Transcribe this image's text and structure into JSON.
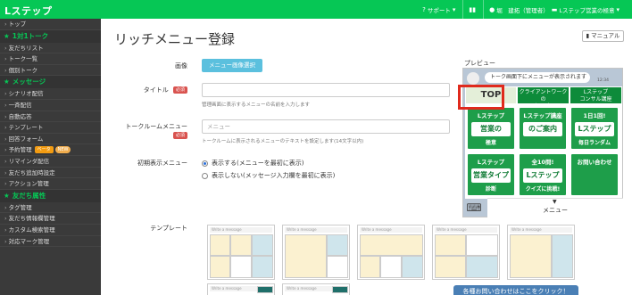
{
  "header": {
    "logo": "Lステップ",
    "support": "サポート",
    "user": "堀　建拓（管理者）",
    "account": "Lステップ営業の極意"
  },
  "sidebar": {
    "items": [
      {
        "type": "item",
        "label": "トップ"
      },
      {
        "type": "head",
        "label": "1対1トーク"
      },
      {
        "type": "item",
        "label": "友だちリスト"
      },
      {
        "type": "item",
        "label": "トーク一覧"
      },
      {
        "type": "item",
        "label": "個別トーク"
      },
      {
        "type": "head",
        "label": "メッセージ"
      },
      {
        "type": "item",
        "label": "シナリオ配信"
      },
      {
        "type": "item",
        "label": "一斉配信"
      },
      {
        "type": "item",
        "label": "自動応答"
      },
      {
        "type": "item",
        "label": "テンプレート"
      },
      {
        "type": "item",
        "label": "回答フォーム"
      },
      {
        "type": "item",
        "label": "予約管理",
        "beta": "ベータ",
        "new": "NEW"
      },
      {
        "type": "item",
        "label": "リマインダ配信"
      },
      {
        "type": "item",
        "label": "友だち追加時設定"
      },
      {
        "type": "item",
        "label": "アクション管理"
      },
      {
        "type": "head",
        "label": "友だち属性"
      },
      {
        "type": "item",
        "label": "タグ管理"
      },
      {
        "type": "item",
        "label": "友だち情報欄管理"
      },
      {
        "type": "item",
        "label": "カスタム検索管理"
      },
      {
        "type": "item",
        "label": "対応マーク管理"
      }
    ]
  },
  "main": {
    "title": "リッチメニュー登録",
    "manual_label": "マニュアル",
    "image_label": "画像",
    "image_button": "メニュー画像選択",
    "title_label": "タイトル",
    "required": "必須",
    "title_value": "",
    "title_help": "管理画面に表示するメニューの名前を入力します",
    "room_menu_label": "トークルームメニュー",
    "room_menu_placeholder": "メニュー",
    "room_menu_help": "トークルームに表示されるメニューのテキストを設定します(14文字以内)",
    "initial_label": "初期表示メニュー",
    "radio_show": "表示する(メニューを最初に表示)",
    "radio_hide": "表示しない(メッセージ入力欄を最初に表示)",
    "template_label": "テンプレート",
    "template_bar_text": "Write a message"
  },
  "preview": {
    "label": "プレビュー",
    "bubble": "トーク画面下にメニューが表示されます",
    "time": "12:34",
    "tab_selected": "TOP",
    "tab2": "クライアントワークの\n極　意",
    "tab3": "Lステップ\nコンサル講座",
    "cards": [
      {
        "top": "Lステップ",
        "mid": "営業の",
        "bot": "極意"
      },
      {
        "top": "Lステップ講座",
        "mid": "のご案内",
        "bot": ""
      },
      {
        "top": "1日1回!",
        "mid": "Lステップ",
        "bot": "毎日ランダム"
      },
      {
        "top": "Lステップ",
        "mid": "営業タイプ",
        "bot": "診断"
      },
      {
        "top": "全10問!",
        "mid": "Lステップ",
        "bot": "クイズに挑戦!"
      },
      {
        "top": "お問い合わせ",
        "mid": "",
        "bot": ""
      }
    ],
    "menu_label": "メニュー"
  },
  "footer": {
    "contact": "各種お問い合わせはここをクリック！"
  },
  "colors": {
    "brand": "#06c755",
    "sidebar_bg": "#3a3a3a",
    "accent_button": "#5bc0de",
    "highlight_box": "#e02a1d"
  }
}
